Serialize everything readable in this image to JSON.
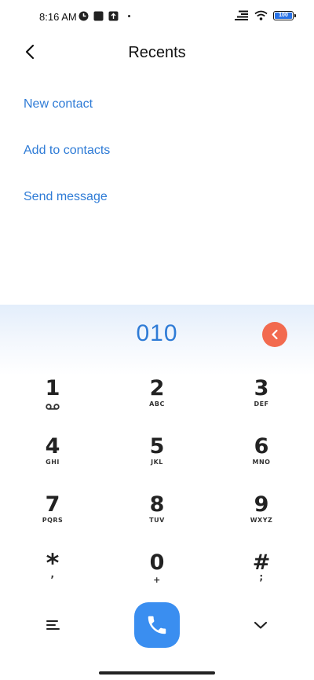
{
  "status_bar": {
    "time": "8:16 AM",
    "battery_level": "100"
  },
  "header": {
    "title": "Recents"
  },
  "actions": {
    "new_contact": "New contact",
    "add_to_contacts": "Add to contacts",
    "send_message": "Send message"
  },
  "dialer": {
    "number": "010",
    "keys": [
      {
        "digit": "1",
        "letters": ""
      },
      {
        "digit": "2",
        "letters": "ABC"
      },
      {
        "digit": "3",
        "letters": "DEF"
      },
      {
        "digit": "4",
        "letters": "GHI"
      },
      {
        "digit": "5",
        "letters": "JKL"
      },
      {
        "digit": "6",
        "letters": "MNO"
      },
      {
        "digit": "7",
        "letters": "PQRS"
      },
      {
        "digit": "8",
        "letters": "TUV"
      },
      {
        "digit": "9",
        "letters": "WXYZ"
      },
      {
        "digit": "*",
        "letters": ","
      },
      {
        "digit": "0",
        "letters": "+"
      },
      {
        "digit": "#",
        "letters": ";"
      }
    ]
  },
  "colors": {
    "accent": "#2e7bd6",
    "call_button": "#3a8ef0",
    "delete_button": "#f26a4f"
  },
  "icons": {
    "back": "chevron-left-icon",
    "delete": "backspace-icon",
    "voicemail": "voicemail-icon",
    "menu": "menu-icon",
    "call": "phone-icon",
    "collapse": "chevron-down-icon"
  }
}
